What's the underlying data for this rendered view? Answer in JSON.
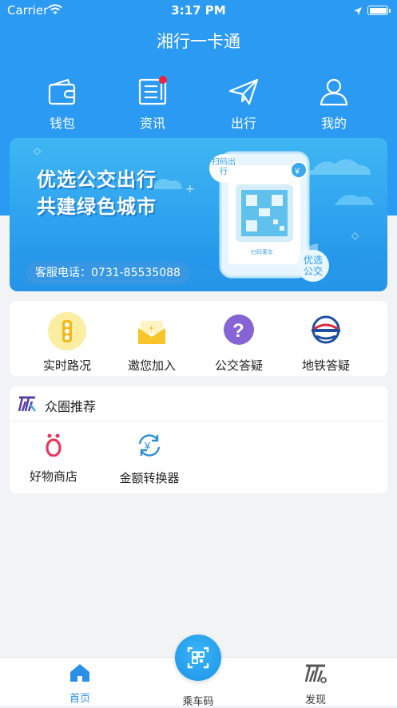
{
  "status_bar": {
    "carrier": "Carrier",
    "time": "3:17 PM"
  },
  "app": {
    "title": "湘行一卡通"
  },
  "top_nav": {
    "items": [
      {
        "label": "钱包",
        "icon": "wallet-icon"
      },
      {
        "label": "资讯",
        "icon": "news-icon",
        "badge": true
      },
      {
        "label": "出行",
        "icon": "paper-plane-icon"
      },
      {
        "label": "我的",
        "icon": "user-icon"
      }
    ]
  },
  "banner": {
    "slogan_line1": "优选公交出行",
    "slogan_line2": "共建绿色城市",
    "phone_label": "客服电话：0731-85535088",
    "scan_bubble": "扫码出行",
    "qr_caption": "扫码乘车",
    "bus_bubble": "优选公交"
  },
  "services": {
    "items": [
      {
        "label": "实时路况",
        "icon": "traffic-light-icon"
      },
      {
        "label": "邀您加入",
        "icon": "invite-envelope-icon"
      },
      {
        "label": "公交答疑",
        "icon": "question-icon"
      },
      {
        "label": "地铁答疑",
        "icon": "metro-icon"
      }
    ]
  },
  "circle": {
    "title": "众圈推荐",
    "apps": [
      {
        "label": "好物商店",
        "icon": "shop-icon"
      },
      {
        "label": "金额转换器",
        "icon": "currency-converter-icon"
      }
    ]
  },
  "tabbar": {
    "tabs": [
      {
        "label": "首页",
        "active": true
      },
      {
        "label": "乘车码",
        "active": false
      },
      {
        "label": "发现",
        "active": false
      }
    ]
  },
  "colors": {
    "primary": "#2b9af3",
    "tab_active": "#2b8fe8",
    "badge": "#f0233a",
    "background": "#f2f3f5"
  }
}
